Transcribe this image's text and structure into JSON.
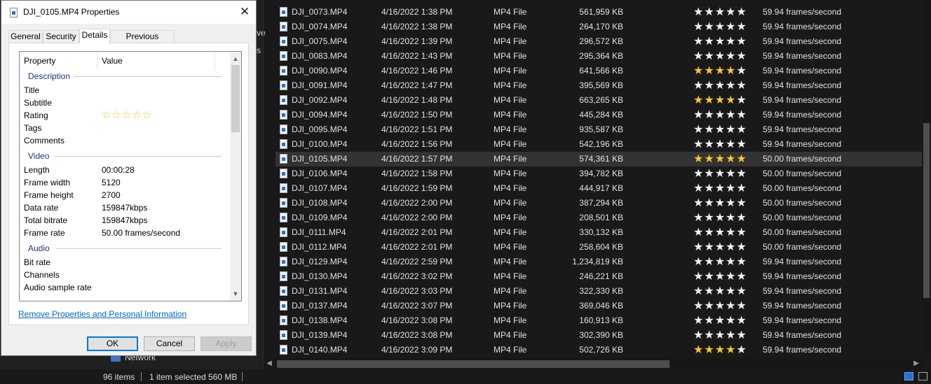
{
  "dialog": {
    "title": "DJI_0105.MP4 Properties",
    "close_symbol": "✕",
    "tabs": [
      "General",
      "Security",
      "Details",
      "Previous Versions"
    ],
    "columns": {
      "property": "Property",
      "value": "Value"
    },
    "groups": {
      "description": "Description",
      "video": "Video",
      "audio": "Audio"
    },
    "description_props": [
      {
        "label": "Title",
        "value": ""
      },
      {
        "label": "Subtitle",
        "value": ""
      },
      {
        "label": "Rating",
        "value": ""
      },
      {
        "label": "Tags",
        "value": ""
      },
      {
        "label": "Comments",
        "value": ""
      }
    ],
    "rating_stars": "☆☆☆☆☆",
    "rating_value": 0,
    "video_props": [
      {
        "label": "Length",
        "value": "00:00:28"
      },
      {
        "label": "Frame width",
        "value": "5120"
      },
      {
        "label": "Frame height",
        "value": "2700"
      },
      {
        "label": "Data rate",
        "value": "159847kbps"
      },
      {
        "label": "Total bitrate",
        "value": "159847kbps"
      },
      {
        "label": "Frame rate",
        "value": "50.00 frames/second"
      }
    ],
    "audio_props": [
      {
        "label": "Bit rate",
        "value": ""
      },
      {
        "label": "Channels",
        "value": ""
      },
      {
        "label": "Audio sample rate",
        "value": ""
      }
    ],
    "remove_link": "Remove Properties and Personal Information",
    "buttons": {
      "ok": "OK",
      "cancel": "Cancel",
      "apply": "Apply"
    }
  },
  "explorer": {
    "nav_fragments": [
      "ve",
      "s"
    ],
    "network_label": "Network",
    "files": [
      {
        "name": "DJI_0073.MP4",
        "date": "4/16/2022 1:38 PM",
        "type": "MP4 File",
        "size": "561,959 KB",
        "rating": 0,
        "fps": "59.94 frames/second"
      },
      {
        "name": "DJI_0074.MP4",
        "date": "4/16/2022 1:38 PM",
        "type": "MP4 File",
        "size": "264,170 KB",
        "rating": 0,
        "fps": "59.94 frames/second"
      },
      {
        "name": "DJI_0075.MP4",
        "date": "4/16/2022 1:39 PM",
        "type": "MP4 File",
        "size": "296,572 KB",
        "rating": 0,
        "fps": "59.94 frames/second"
      },
      {
        "name": "DJI_0083.MP4",
        "date": "4/16/2022 1:43 PM",
        "type": "MP4 File",
        "size": "295,364 KB",
        "rating": 0,
        "fps": "59.94 frames/second"
      },
      {
        "name": "DJI_0090.MP4",
        "date": "4/16/2022 1:46 PM",
        "type": "MP4 File",
        "size": "641,566 KB",
        "rating": 4,
        "fps": "59.94 frames/second"
      },
      {
        "name": "DJI_0091.MP4",
        "date": "4/16/2022 1:47 PM",
        "type": "MP4 File",
        "size": "395,569 KB",
        "rating": 0,
        "fps": "59.94 frames/second"
      },
      {
        "name": "DJI_0092.MP4",
        "date": "4/16/2022 1:48 PM",
        "type": "MP4 File",
        "size": "663,265 KB",
        "rating": 4,
        "fps": "59.94 frames/second"
      },
      {
        "name": "DJI_0094.MP4",
        "date": "4/16/2022 1:50 PM",
        "type": "MP4 File",
        "size": "445,284 KB",
        "rating": 0,
        "fps": "59.94 frames/second"
      },
      {
        "name": "DJI_0095.MP4",
        "date": "4/16/2022 1:51 PM",
        "type": "MP4 File",
        "size": "935,587 KB",
        "rating": 0,
        "fps": "59.94 frames/second"
      },
      {
        "name": "DJI_0100.MP4",
        "date": "4/16/2022 1:56 PM",
        "type": "MP4 File",
        "size": "542,196 KB",
        "rating": 0,
        "fps": "59.94 frames/second"
      },
      {
        "name": "DJI_0105.MP4",
        "date": "4/16/2022 1:57 PM",
        "type": "MP4 File",
        "size": "574,361 KB",
        "rating": 5,
        "fps": "50.00 frames/second",
        "selected": true
      },
      {
        "name": "DJI_0106.MP4",
        "date": "4/16/2022 1:58 PM",
        "type": "MP4 File",
        "size": "394,782 KB",
        "rating": 0,
        "fps": "50.00 frames/second"
      },
      {
        "name": "DJI_0107.MP4",
        "date": "4/16/2022 1:59 PM",
        "type": "MP4 File",
        "size": "444,917 KB",
        "rating": 0,
        "fps": "50.00 frames/second"
      },
      {
        "name": "DJI_0108.MP4",
        "date": "4/16/2022 2:00 PM",
        "type": "MP4 File",
        "size": "387,294 KB",
        "rating": 0,
        "fps": "50.00 frames/second"
      },
      {
        "name": "DJI_0109.MP4",
        "date": "4/16/2022 2:00 PM",
        "type": "MP4 File",
        "size": "208,501 KB",
        "rating": 0,
        "fps": "50.00 frames/second"
      },
      {
        "name": "DJI_0111.MP4",
        "date": "4/16/2022 2:01 PM",
        "type": "MP4 File",
        "size": "330,132 KB",
        "rating": 0,
        "fps": "50.00 frames/second"
      },
      {
        "name": "DJI_0112.MP4",
        "date": "4/16/2022 2:01 PM",
        "type": "MP4 File",
        "size": "258,604 KB",
        "rating": 0,
        "fps": "50.00 frames/second"
      },
      {
        "name": "DJI_0129.MP4",
        "date": "4/16/2022 2:59 PM",
        "type": "MP4 File",
        "size": "1,234,819 KB",
        "rating": 0,
        "fps": "59.94 frames/second"
      },
      {
        "name": "DJI_0130.MP4",
        "date": "4/16/2022 3:02 PM",
        "type": "MP4 File",
        "size": "246,221 KB",
        "rating": 0,
        "fps": "59.94 frames/second"
      },
      {
        "name": "DJI_0131.MP4",
        "date": "4/16/2022 3:03 PM",
        "type": "MP4 File",
        "size": "322,330 KB",
        "rating": 0,
        "fps": "59.94 frames/second"
      },
      {
        "name": "DJI_0137.MP4",
        "date": "4/16/2022 3:07 PM",
        "type": "MP4 File",
        "size": "369,046 KB",
        "rating": 0,
        "fps": "59.94 frames/second"
      },
      {
        "name": "DJI_0138.MP4",
        "date": "4/16/2022 3:08 PM",
        "type": "MP4 File",
        "size": "160,913 KB",
        "rating": 0,
        "fps": "59.94 frames/second"
      },
      {
        "name": "DJI_0139.MP4",
        "date": "4/16/2022 3:08 PM",
        "type": "MP4 File",
        "size": "302,390 KB",
        "rating": 0,
        "fps": "59.94 frames/second"
      },
      {
        "name": "DJI_0140.MP4",
        "date": "4/16/2022 3:09 PM",
        "type": "MP4 File",
        "size": "502,726 KB",
        "rating": 4,
        "fps": "59.94 frames/second"
      }
    ]
  },
  "status": {
    "items_count": "96 items",
    "selection": "1 item selected",
    "selection_size": "560 MB"
  },
  "colors": {
    "star_on": "#f8c62e",
    "star_off": "#f2f2f2",
    "selection_bg": "#333333",
    "link": "#0066cc",
    "default_button_border": "#0078d7"
  },
  "icons": [
    "mp4-file-icon",
    "close-icon",
    "network-icon",
    "details-view-icon",
    "tiles-view-icon",
    "scroll-left-arrow-icon",
    "scroll-right-arrow-icon",
    "scroll-up-arrow-icon",
    "scroll-down-arrow-icon"
  ]
}
